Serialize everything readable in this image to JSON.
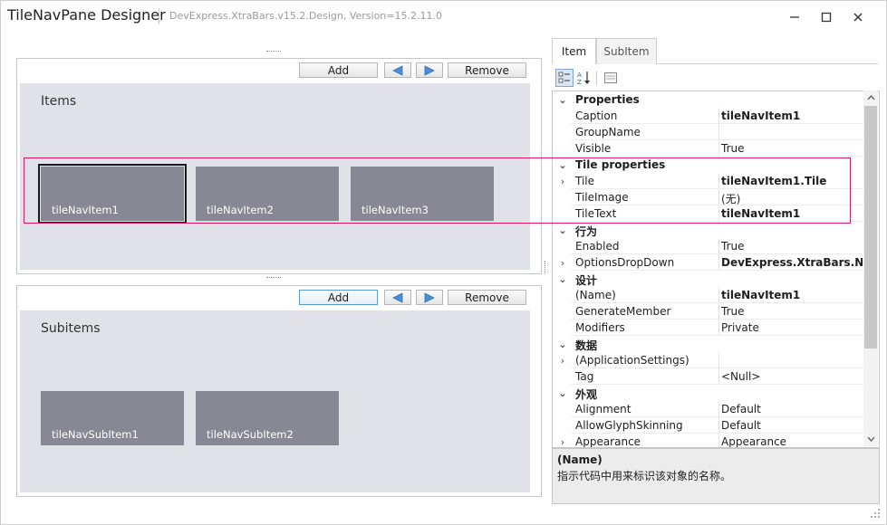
{
  "window": {
    "title": "TileNavPane Designer",
    "subtitle": "DevExpress.XtraBars.v15.2.Design, Version=15.2.11.0",
    "minimize": "—",
    "maximize": "☐",
    "close": "✕"
  },
  "items_panel": {
    "add_label": "Add",
    "remove_label": "Remove",
    "caption": "Items",
    "tiles": [
      "tileNavItem1",
      "tileNavItem2",
      "tileNavItem3"
    ]
  },
  "subitems_panel": {
    "add_label": "Add",
    "remove_label": "Remove",
    "caption": "Subitems",
    "tiles": [
      "tileNavSubItem1",
      "tileNavSubItem2"
    ]
  },
  "tabs": [
    "Item",
    "SubItem"
  ],
  "property_grid": {
    "rows": [
      {
        "kind": "cat",
        "name": "Properties",
        "expander": "⌄"
      },
      {
        "kind": "prop",
        "name": "Caption",
        "value": "tileNavItem1",
        "bold": true,
        "expander": ""
      },
      {
        "kind": "prop",
        "name": "GroupName",
        "value": "",
        "bold": false,
        "expander": ""
      },
      {
        "kind": "prop",
        "name": "Visible",
        "value": "True",
        "bold": false,
        "expander": ""
      },
      {
        "kind": "cat",
        "name": "Tile properties",
        "expander": "⌄"
      },
      {
        "kind": "prop",
        "name": "Tile",
        "value": "tileNavItem1.Tile",
        "bold": true,
        "expander": "›"
      },
      {
        "kind": "prop",
        "name": "TileImage",
        "value": "(无)",
        "bold": false,
        "expander": ""
      },
      {
        "kind": "prop",
        "name": "TileText",
        "value": "tileNavItem1",
        "bold": true,
        "expander": ""
      },
      {
        "kind": "cat",
        "name": "行为",
        "expander": "⌄"
      },
      {
        "kind": "prop",
        "name": "Enabled",
        "value": "True",
        "bold": false,
        "expander": ""
      },
      {
        "kind": "prop",
        "name": "OptionsDropDown",
        "value": "DevExpress.XtraBars.Navig",
        "bold": true,
        "expander": "›"
      },
      {
        "kind": "cat",
        "name": "设计",
        "expander": "⌄"
      },
      {
        "kind": "prop",
        "name": "(Name)",
        "value": "tileNavItem1",
        "bold": true,
        "expander": ""
      },
      {
        "kind": "prop",
        "name": "GenerateMember",
        "value": "True",
        "bold": false,
        "expander": ""
      },
      {
        "kind": "prop",
        "name": "Modifiers",
        "value": "Private",
        "bold": false,
        "expander": ""
      },
      {
        "kind": "cat",
        "name": "数据",
        "expander": "⌄"
      },
      {
        "kind": "prop",
        "name": "(ApplicationSettings)",
        "value": "",
        "bold": false,
        "expander": "›"
      },
      {
        "kind": "prop",
        "name": "Tag",
        "value": "<Null>",
        "bold": false,
        "expander": ""
      },
      {
        "kind": "cat",
        "name": "外观",
        "expander": "⌄"
      },
      {
        "kind": "prop",
        "name": "Alignment",
        "value": "Default",
        "bold": false,
        "expander": ""
      },
      {
        "kind": "prop",
        "name": "AllowGlyphSkinning",
        "value": "Default",
        "bold": false,
        "expander": ""
      },
      {
        "kind": "prop",
        "name": "Appearance",
        "value": "Appearance",
        "bold": false,
        "expander": "›"
      }
    ]
  },
  "description": {
    "title": "(Name)",
    "text": "指示代码中用来标识该对象的名称。"
  }
}
